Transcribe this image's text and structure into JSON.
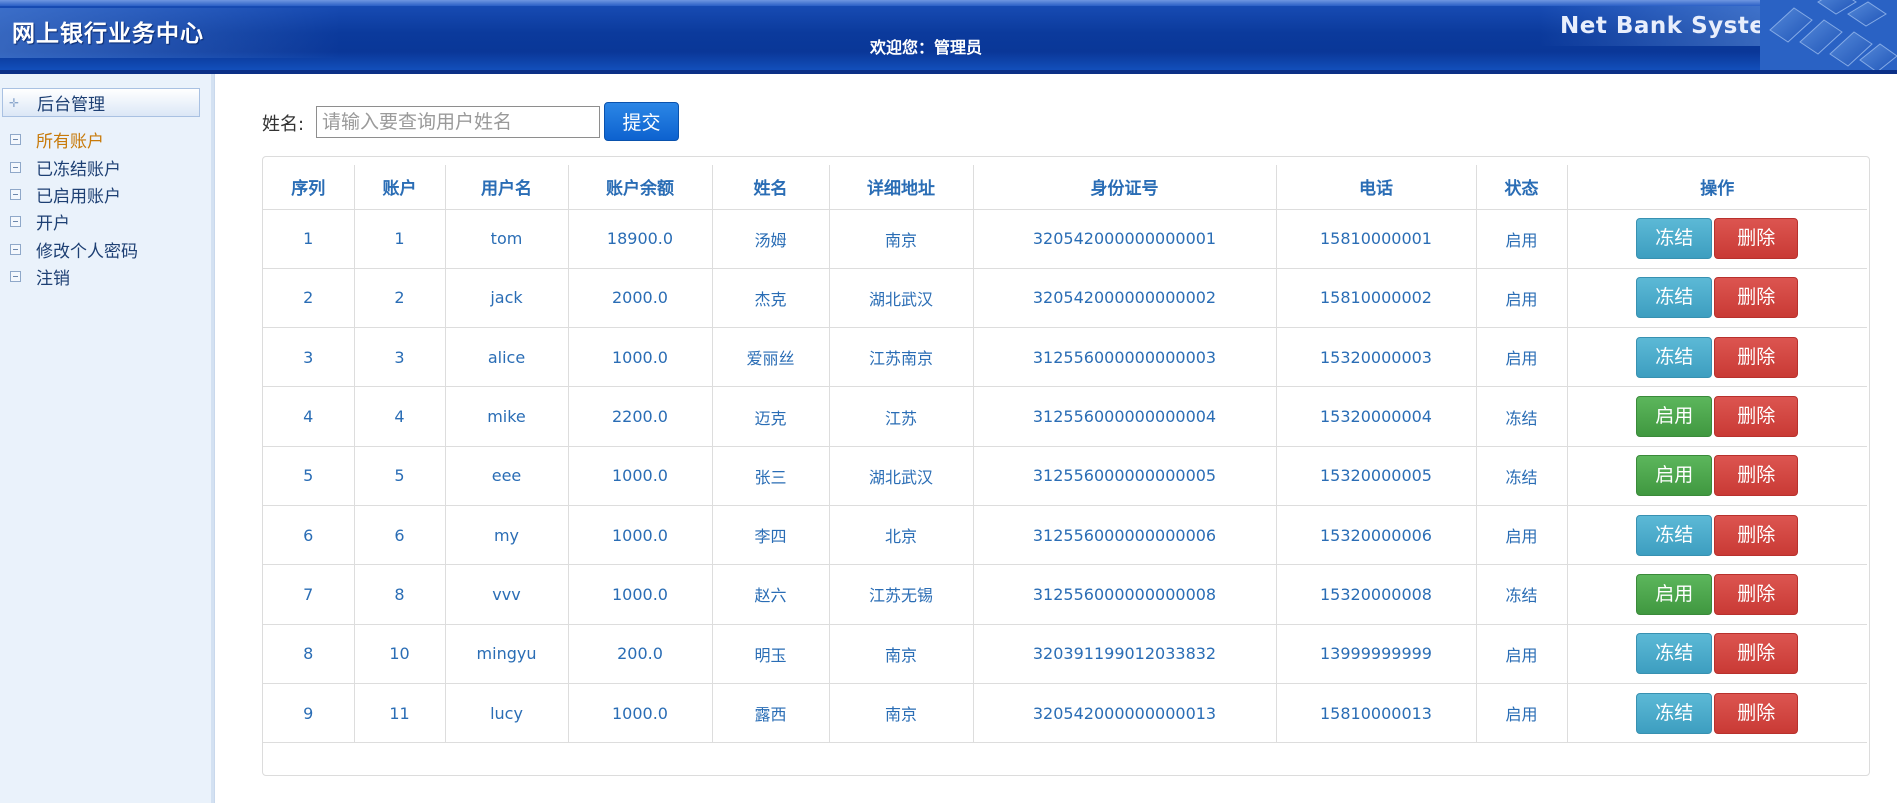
{
  "header": {
    "app_title": "网上银行业务中心",
    "welcome": "欢迎您：管理员",
    "brand_en": "Net Bank System"
  },
  "sidebar": {
    "section_title": "后台管理",
    "items": [
      {
        "label": "所有账户",
        "active": true
      },
      {
        "label": "已冻结账户",
        "active": false
      },
      {
        "label": "已启用账户",
        "active": false
      },
      {
        "label": "开户",
        "active": false
      },
      {
        "label": "修改个人密码",
        "active": false
      },
      {
        "label": "注销",
        "active": false
      }
    ]
  },
  "search": {
    "label": "姓名:",
    "placeholder": "请输入要查询用户姓名",
    "value": "",
    "submit_label": "提交"
  },
  "table": {
    "columns": [
      "序列",
      "账户",
      "用户名",
      "账户余额",
      "姓名",
      "详细地址",
      "身份证号",
      "电话",
      "状态",
      "操作"
    ],
    "rows": [
      {
        "seq": "1",
        "account": "1",
        "username": "tom",
        "balance": "18900.0",
        "name": "汤姆",
        "address": "南京",
        "id_card": "320542000000000001",
        "phone": "15810000001",
        "status": "启用",
        "toggle_label": "冻结",
        "toggle_kind": "freeze",
        "delete_label": "删除"
      },
      {
        "seq": "2",
        "account": "2",
        "username": "jack",
        "balance": "2000.0",
        "name": "杰克",
        "address": "湖北武汉",
        "id_card": "320542000000000002",
        "phone": "15810000002",
        "status": "启用",
        "toggle_label": "冻结",
        "toggle_kind": "freeze",
        "delete_label": "删除"
      },
      {
        "seq": "3",
        "account": "3",
        "username": "alice",
        "balance": "1000.0",
        "name": "爱丽丝",
        "address": "江苏南京",
        "id_card": "312556000000000003",
        "phone": "15320000003",
        "status": "启用",
        "toggle_label": "冻结",
        "toggle_kind": "freeze",
        "delete_label": "删除"
      },
      {
        "seq": "4",
        "account": "4",
        "username": "mike",
        "balance": "2200.0",
        "name": "迈克",
        "address": "江苏",
        "id_card": "312556000000000004",
        "phone": "15320000004",
        "status": "冻结",
        "toggle_label": "启用",
        "toggle_kind": "enable",
        "delete_label": "删除"
      },
      {
        "seq": "5",
        "account": "5",
        "username": "eee",
        "balance": "1000.0",
        "name": "张三",
        "address": "湖北武汉",
        "id_card": "312556000000000005",
        "phone": "15320000005",
        "status": "冻结",
        "toggle_label": "启用",
        "toggle_kind": "enable",
        "delete_label": "删除"
      },
      {
        "seq": "6",
        "account": "6",
        "username": "my",
        "balance": "1000.0",
        "name": "李四",
        "address": "北京",
        "id_card": "312556000000000006",
        "phone": "15320000006",
        "status": "启用",
        "toggle_label": "冻结",
        "toggle_kind": "freeze",
        "delete_label": "删除"
      },
      {
        "seq": "7",
        "account": "8",
        "username": "vvv",
        "balance": "1000.0",
        "name": "赵六",
        "address": "江苏无锡",
        "id_card": "312556000000000008",
        "phone": "15320000008",
        "status": "冻结",
        "toggle_label": "启用",
        "toggle_kind": "enable",
        "delete_label": "删除"
      },
      {
        "seq": "8",
        "account": "10",
        "username": "mingyu",
        "balance": "200.0",
        "name": "明玉",
        "address": "南京",
        "id_card": "320391199012033832",
        "phone": "13999999999",
        "status": "启用",
        "toggle_label": "冻结",
        "toggle_kind": "freeze",
        "delete_label": "删除"
      },
      {
        "seq": "9",
        "account": "11",
        "username": "lucy",
        "balance": "1000.0",
        "name": "露西",
        "address": "南京",
        "id_card": "320542000000000013",
        "phone": "15810000013",
        "status": "启用",
        "toggle_label": "冻结",
        "toggle_kind": "freeze",
        "delete_label": "删除"
      }
    ]
  },
  "colors": {
    "header_blue": "#0b3a9c",
    "link_blue": "#2a6db5",
    "active_item": "#c87a0a",
    "freeze_button": "#3d9ec0",
    "enable_button": "#409840",
    "delete_button": "#c93a35"
  }
}
